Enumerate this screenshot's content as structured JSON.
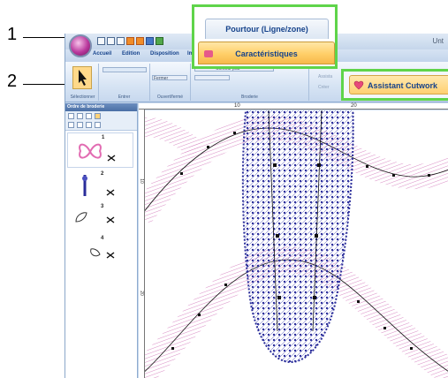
{
  "callouts": {
    "one": "1",
    "two": "2"
  },
  "window": {
    "title": "Unt"
  },
  "ribbon_tabs": [
    "Accueil",
    "Edition",
    "Disposition",
    "Im"
  ],
  "ribbon_groups": {
    "select": "Sélectionner",
    "enter": "Entrer",
    "open_close": "Ouvert/fermé",
    "embroidery": "Broderie"
  },
  "ribbon_controls": {
    "close_dropdown": "Fermer",
    "outline_combo": "Contour plat",
    "wizard_short": "Assista",
    "create_short": "Créer"
  },
  "context_tabs": {
    "outline_tab": "Pourtour (Ligne/zone)",
    "properties_tab": "Caractéristiques"
  },
  "cutwork_button": "Assistant Cutwork",
  "embroidery_panel": {
    "title": "Ordre de broderie",
    "items": [
      {
        "num": "1",
        "icon": "butterfly-outline-icon"
      },
      {
        "num": "2",
        "icon": "needle-icon"
      },
      {
        "num": "3",
        "icon": "leaf-outline-icon"
      },
      {
        "num": "4",
        "icon": "petal-outline-icon"
      }
    ]
  },
  "ruler": {
    "top_labels": [
      "10",
      "20"
    ],
    "left_labels": [
      "10",
      "20"
    ]
  },
  "colors": {
    "accent_green": "#5fd44a",
    "blue_stitch": "#2a2d9a",
    "pink_stitch": "#d98bc4",
    "ribbon_blue": "#15428b"
  }
}
